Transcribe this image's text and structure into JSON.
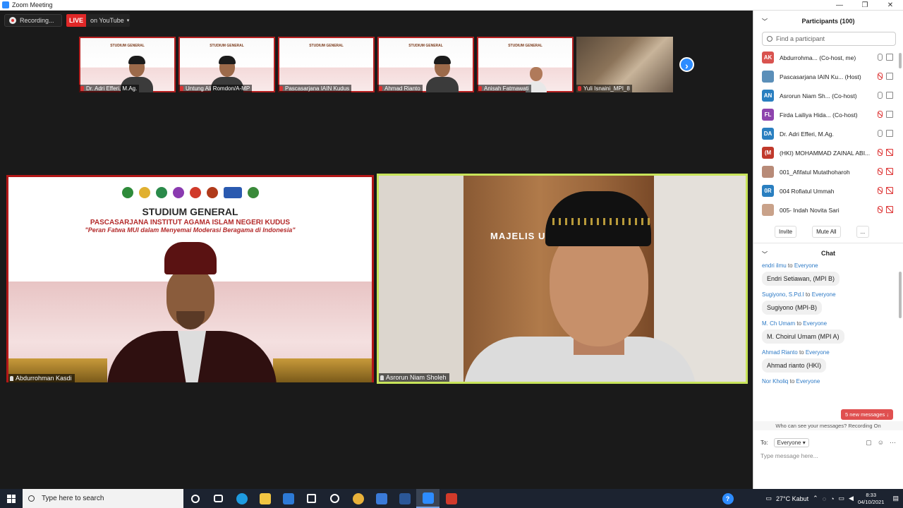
{
  "window": {
    "title": "Zoom Meeting",
    "controls": [
      "—",
      "❐",
      "✕"
    ]
  },
  "top_bar": {
    "recording_label": "Recording...",
    "live_label": "LIVE",
    "youtube_label": "on YouTube",
    "dropdown_glyph": "▾"
  },
  "thumbnails": [
    {
      "name": "Dr. Adri Efferi, M.Ag.",
      "banner": "STUDIUM GENERAL"
    },
    {
      "name": "Untung Ali Romdon/A-MP",
      "banner": "STUDIUM GENERAL"
    },
    {
      "name": "Pascasarjana IAIN Kudus",
      "banner": "STUDIUM GENERAL"
    },
    {
      "name": "Ahmad Rianto",
      "banner": "STUDIUM GENERAL"
    },
    {
      "name": "Anisah Fatmawati",
      "banner": "STUDIUM GENERAL"
    },
    {
      "name": "Yuli Isnaini_MPI_8",
      "banner": ""
    }
  ],
  "next_page_glyph": "›",
  "main_tiles": {
    "left": {
      "name": "Abdurrohman Kasdi",
      "title": "STUDIUM GENERAL",
      "subtitle": "PASCASARJANA INSTITUT AGAMA ISLAM NEGERI KUDUS",
      "tagline": "\"Peran Fatwa MUI dalam Menyemai Moderasi Beragama di Indonesia\""
    },
    "right": {
      "name": "Asrorun Niam Sholeh",
      "sign_text": "MAJELIS U"
    }
  },
  "participants": {
    "header": "Participants (100)",
    "search_placeholder": "Find a participant",
    "list": [
      {
        "initials": "AK",
        "name": "Abdurrohma... (Co-host, me)",
        "color": "#d9534f",
        "mic_off": false,
        "cam_off": false
      },
      {
        "initials": "",
        "name": "Pascasarjana IAIN Ku... (Host)",
        "color": "#5b8fb9",
        "mic_off": true,
        "cam_off": false
      },
      {
        "initials": "AN",
        "name": "Asrorun Niam Sh... (Co-host)",
        "color": "#2a7fc0",
        "mic_off": false,
        "cam_off": false
      },
      {
        "initials": "FL",
        "name": "Firda Lailiya Hida... (Co-host)",
        "color": "#8e44ad",
        "mic_off": true,
        "cam_off": false
      },
      {
        "initials": "DA",
        "name": "Dr. Adri Efferi, M.Ag.",
        "color": "#2a7fc0",
        "mic_off": false,
        "cam_off": false
      },
      {
        "initials": "(M",
        "name": "(HKI) MOHAMMAD ZAINAL ABI...",
        "color": "#c0392b",
        "mic_off": true,
        "cam_off": true
      },
      {
        "initials": "",
        "name": "001_Afifatul Mutathoharoh",
        "color": "#b88b78",
        "mic_off": true,
        "cam_off": true
      },
      {
        "initials": "0R",
        "name": "004 Rofiatul Ummah",
        "color": "#2a7fc0",
        "mic_off": true,
        "cam_off": true
      },
      {
        "initials": "",
        "name": "005- Indah Novita Sari",
        "color": "#c9a28a",
        "mic_off": true,
        "cam_off": true
      }
    ],
    "buttons": [
      "Invite",
      "Mute All",
      "..."
    ]
  },
  "chat": {
    "header": "Chat",
    "to_word": "to",
    "messages": [
      {
        "from": "endri ilmu",
        "to": "Everyone",
        "text": "Endri Setiawan, (MPI B)"
      },
      {
        "from": "Sugiyono, S.Pd.I",
        "to": "Everyone",
        "text": "Sugiyono (MPI-B)"
      },
      {
        "from": "M. Ch Umam",
        "to": "Everyone",
        "text": "M. Choirul Umam (MPI A)"
      },
      {
        "from": "Ahmad Rianto",
        "to": "Everyone",
        "text": "Ahmad rianto (HKI)"
      },
      {
        "from": "Nor Kholiq",
        "to": "Everyone",
        "text": ""
      }
    ],
    "new_messages": "5 new messages ↓",
    "visibility_note": "Who can see your messages? Recording On",
    "to_label": "To:",
    "to_value": "Everyone",
    "input_placeholder": "Type message here..."
  },
  "taskbar": {
    "search_placeholder": "Type here to search",
    "apps": [
      {
        "name": "cortana",
        "color": "#1c2330",
        "active": false
      },
      {
        "name": "task-view",
        "color": "#1c2330",
        "active": false
      },
      {
        "name": "edge",
        "color": "#1e9be0",
        "active": false
      },
      {
        "name": "file-explorer",
        "color": "#f2c542",
        "active": false
      },
      {
        "name": "mail",
        "color": "#2d7ad6",
        "active": false
      },
      {
        "name": "dropbox",
        "color": "#1c2330",
        "active": false
      },
      {
        "name": "app-circle",
        "color": "#1c2330",
        "active": false
      },
      {
        "name": "chrome",
        "color": "#e8b13a",
        "active": false
      },
      {
        "name": "photos",
        "color": "#3a7ad8",
        "active": false
      },
      {
        "name": "word",
        "color": "#2b5797",
        "active": false
      },
      {
        "name": "zoom",
        "color": "#2d8cff",
        "active": true
      },
      {
        "name": "acrobat",
        "color": "#d13a2a",
        "active": false
      }
    ],
    "help_glyph": "?",
    "weather": "27°C  Kabut",
    "time": "8:33",
    "date": "04/10/2021"
  }
}
